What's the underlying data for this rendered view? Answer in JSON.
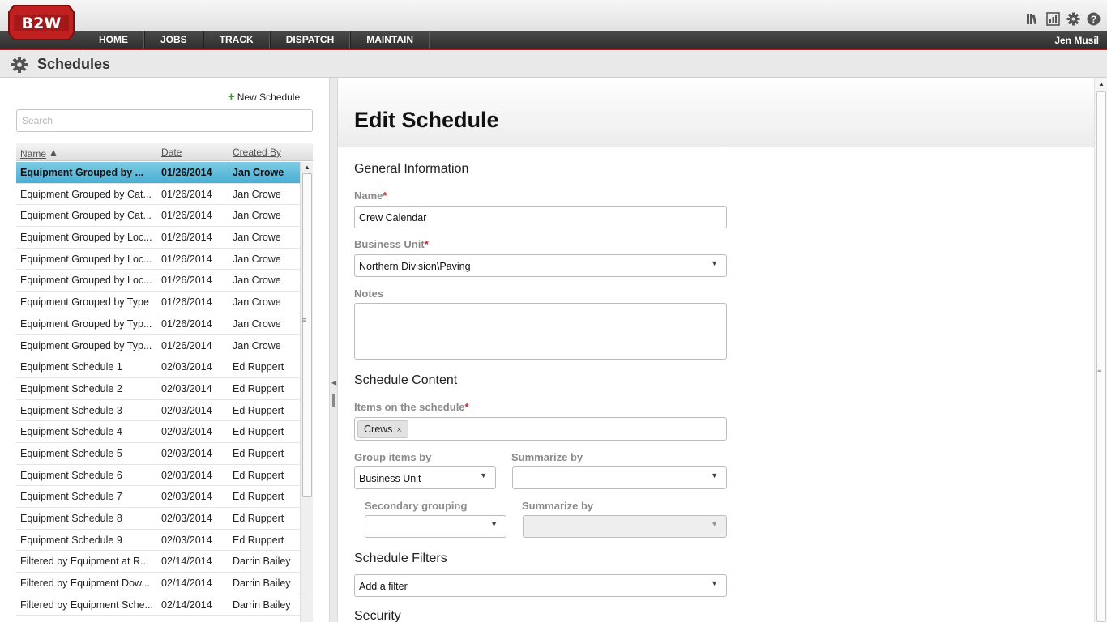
{
  "app": {
    "logo_text": "B2W",
    "nav": [
      "HOME",
      "JOBS",
      "TRACK",
      "DISPATCH",
      "MAINTAIN"
    ],
    "user": "Jen Musil",
    "utility_icons": [
      "library-icon",
      "reports-icon",
      "settings-icon",
      "help-icon"
    ]
  },
  "page": {
    "title": "Schedules"
  },
  "list": {
    "new_label": "New Schedule",
    "search_placeholder": "Search",
    "columns": {
      "name": "Name",
      "date": "Date",
      "created_by": "Created By"
    },
    "sort_indicator": "▲",
    "rows": [
      {
        "name": "Equipment Grouped by ...",
        "date": "01/26/2014",
        "by": "Jan Crowe"
      },
      {
        "name": "Equipment Grouped by Cat...",
        "date": "01/26/2014",
        "by": "Jan Crowe"
      },
      {
        "name": "Equipment Grouped by Cat...",
        "date": "01/26/2014",
        "by": "Jan Crowe"
      },
      {
        "name": "Equipment Grouped by Loc...",
        "date": "01/26/2014",
        "by": "Jan Crowe"
      },
      {
        "name": "Equipment Grouped by Loc...",
        "date": "01/26/2014",
        "by": "Jan Crowe"
      },
      {
        "name": "Equipment Grouped by Loc...",
        "date": "01/26/2014",
        "by": "Jan Crowe"
      },
      {
        "name": "Equipment Grouped by Type",
        "date": "01/26/2014",
        "by": "Jan Crowe"
      },
      {
        "name": "Equipment Grouped by Typ...",
        "date": "01/26/2014",
        "by": "Jan Crowe"
      },
      {
        "name": "Equipment Grouped by Typ...",
        "date": "01/26/2014",
        "by": "Jan Crowe"
      },
      {
        "name": "Equipment Schedule 1",
        "date": "02/03/2014",
        "by": "Ed Ruppert"
      },
      {
        "name": "Equipment Schedule 2",
        "date": "02/03/2014",
        "by": "Ed Ruppert"
      },
      {
        "name": "Equipment Schedule 3",
        "date": "02/03/2014",
        "by": "Ed Ruppert"
      },
      {
        "name": "Equipment Schedule 4",
        "date": "02/03/2014",
        "by": "Ed Ruppert"
      },
      {
        "name": "Equipment Schedule 5",
        "date": "02/03/2014",
        "by": "Ed Ruppert"
      },
      {
        "name": "Equipment Schedule 6",
        "date": "02/03/2014",
        "by": "Ed Ruppert"
      },
      {
        "name": "Equipment Schedule 7",
        "date": "02/03/2014",
        "by": "Ed Ruppert"
      },
      {
        "name": "Equipment Schedule 8",
        "date": "02/03/2014",
        "by": "Ed Ruppert"
      },
      {
        "name": "Equipment Schedule 9",
        "date": "02/03/2014",
        "by": "Ed Ruppert"
      },
      {
        "name": "Filtered by Equipment at R...",
        "date": "02/14/2014",
        "by": "Darrin Bailey"
      },
      {
        "name": "Filtered by Equipment Dow...",
        "date": "02/14/2014",
        "by": "Darrin Bailey"
      },
      {
        "name": "Filtered by Equipment Sche...",
        "date": "02/14/2014",
        "by": "Darrin Bailey"
      }
    ]
  },
  "edit": {
    "title": "Edit Schedule",
    "general": {
      "heading": "General Information",
      "name_label": "Name",
      "name_value": "Crew Calendar",
      "bu_label": "Business Unit",
      "bu_value": "Northern Division\\Paving",
      "notes_label": "Notes",
      "notes_value": ""
    },
    "content": {
      "heading": "Schedule Content",
      "items_label": "Items on the schedule",
      "items_tag": "Crews",
      "tag_remove": "×",
      "group_label": "Group items by",
      "group_value": "Business Unit",
      "summarize_label": "Summarize by",
      "summarize_value": "",
      "secondary_label": "Secondary grouping",
      "secondary_value": "",
      "summarize2_label": "Summarize by",
      "summarize2_value": ""
    },
    "filters": {
      "heading": "Schedule Filters",
      "placeholder": "Add a filter"
    },
    "security": {
      "heading": "Security"
    },
    "required_marker": "*",
    "dropdown_glyph": "▼"
  },
  "colors": {
    "brand_red": "#b81c1c",
    "selected_row": "#5bbadc",
    "add_green": "#3a9b2c"
  }
}
